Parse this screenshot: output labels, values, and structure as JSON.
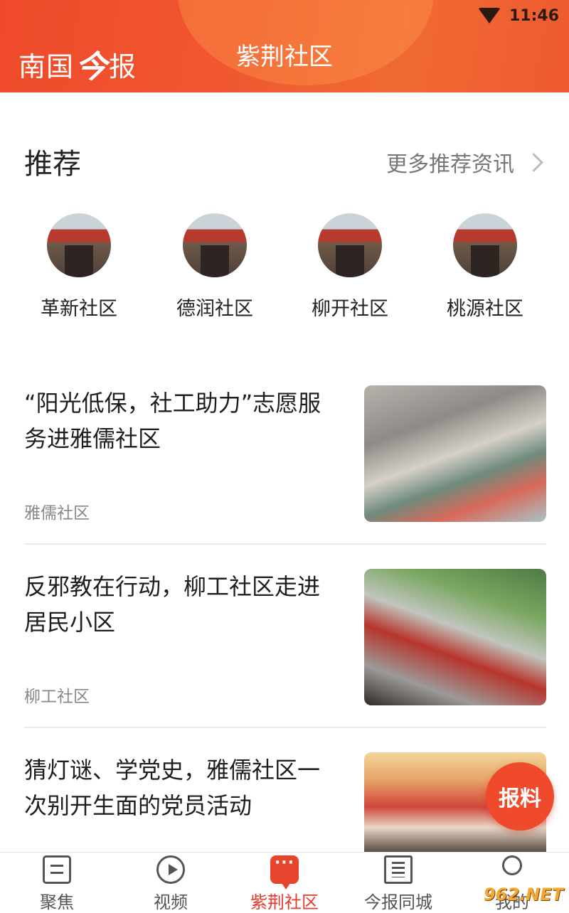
{
  "status_bar": {
    "time": "11:46"
  },
  "header": {
    "logo_prefix": "南国",
    "logo_mark": "今",
    "logo_suffix": "报",
    "title": "紫荆社区",
    "accent_color": "#ef4a2c"
  },
  "recommend": {
    "title": "推荐",
    "more_label": "更多推荐资讯",
    "communities": [
      {
        "name": "革新社区"
      },
      {
        "name": "德润社区"
      },
      {
        "name": "柳开社区"
      },
      {
        "name": "桃源社区"
      }
    ]
  },
  "news": [
    {
      "title": "“阳光低保，社工助力”志愿服务进雅儒社区",
      "source": "雅儒社区"
    },
    {
      "title": "反邪教在行动，柳工社区走进居民小区",
      "source": "柳工社区"
    },
    {
      "title": "猜灯谜、学党史，雅儒社区一次别开生面的党员活动",
      "source": ""
    }
  ],
  "fab": {
    "label": "报料"
  },
  "tabbar": {
    "tabs": [
      {
        "label": "聚焦",
        "icon": "document-icon",
        "active": false
      },
      {
        "label": "视频",
        "icon": "play-icon",
        "active": false
      },
      {
        "label": "紫荆社区",
        "icon": "chat-bubble-icon",
        "active": true
      },
      {
        "label": "今报同城",
        "icon": "building-icon",
        "active": false
      },
      {
        "label": "我的",
        "icon": "user-icon",
        "active": false
      }
    ],
    "active_color": "#e43b2a"
  },
  "watermark": {
    "text": "962.NET"
  }
}
